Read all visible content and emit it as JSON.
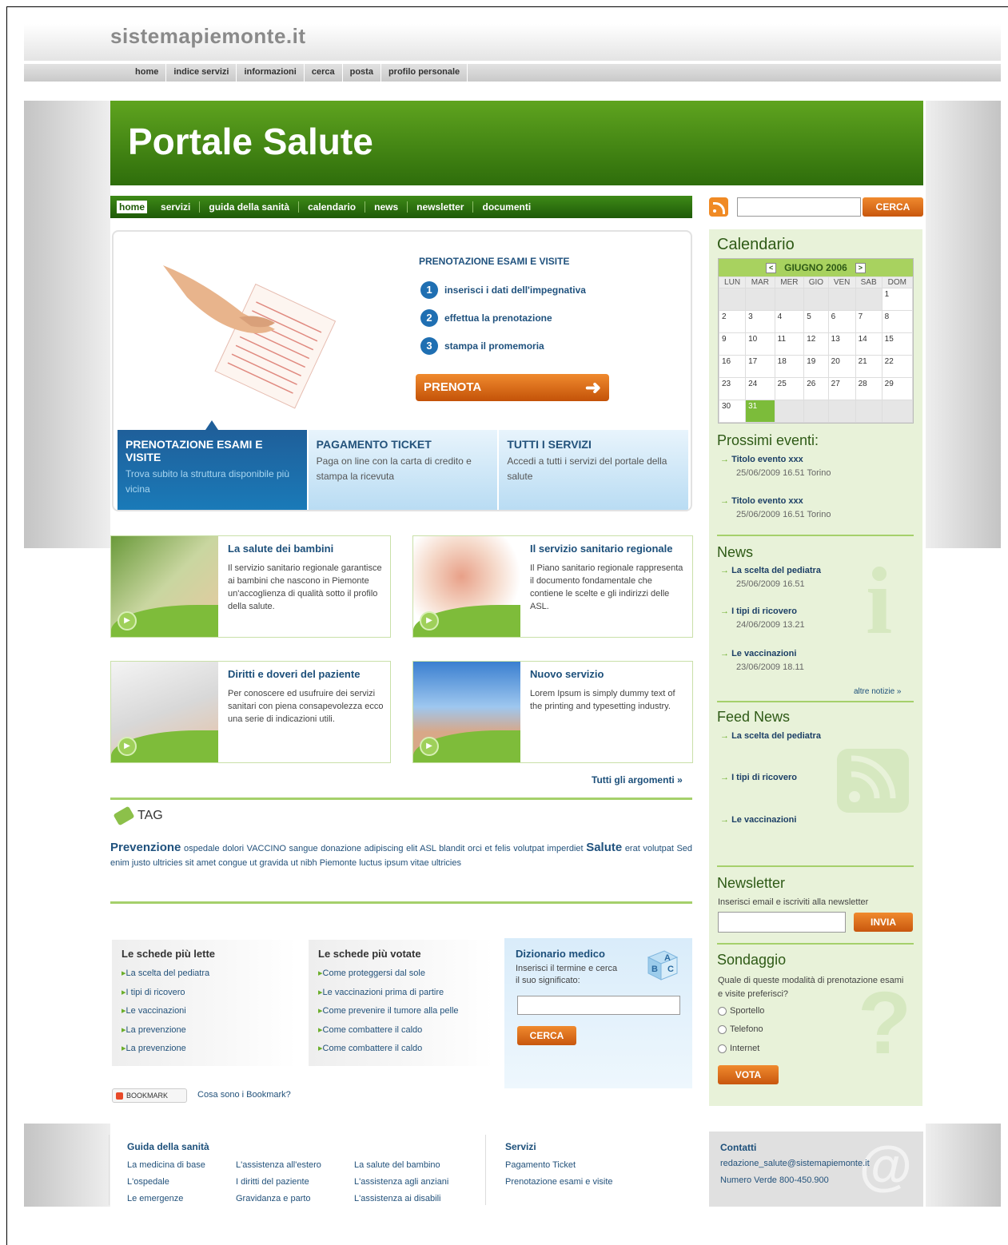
{
  "site": {
    "logo": "sistemapiemonte.it"
  },
  "top_nav": [
    "home",
    "indice servizi",
    "informazioni",
    "cerca",
    "posta",
    "profilo personale"
  ],
  "hero": {
    "title": "Portale Salute"
  },
  "main_nav": [
    "home",
    "servizi",
    "guida della sanità",
    "calendario",
    "news",
    "newsletter",
    "documenti"
  ],
  "search": {
    "button": "CERCA"
  },
  "booking": {
    "title": "PRENOTAZIONE ESAMI E VISITE",
    "steps": [
      {
        "num": "1",
        "text": "inserisci i dati dell'impegnativa"
      },
      {
        "num": "2",
        "text": "effettua la prenotazione"
      },
      {
        "num": "3",
        "text": "stampa il promemoria"
      }
    ],
    "button": "PRENOTA",
    "tabs": [
      {
        "title": "PRENOTAZIONE ESAMI E VISITE",
        "text": "Trova subito la struttura disponibile più vicina"
      },
      {
        "title": "PAGAMENTO TICKET",
        "text": "Paga on line con la carta di credito e stampa la ricevuta"
      },
      {
        "title": "TUTTI I SERVIZI",
        "text": "Accedi a tutti i servizi del portale della salute"
      }
    ]
  },
  "cards": [
    {
      "title": "La salute dei bambini",
      "text": "Il servizio sanitario regionale garantisce ai bambini che nascono in Piemonte un'accoglienza di qualità sotto il profilo della salute."
    },
    {
      "title": "Il servizio sanitario regionale",
      "text": "Il Piano sanitario regionale rappresenta il documento fondamentale che contiene le scelte e gli indirizzi delle ASL."
    },
    {
      "title": "Diritti e doveri del paziente",
      "text": "Per conoscere ed usufruire dei servizi sanitari con piena consapevolezza ecco una serie di indicazioni utili."
    },
    {
      "title": "Nuovo servizio",
      "text": "Lorem Ipsum is simply dummy text of the printing and typesetting industry."
    }
  ],
  "all_topics": "Tutti gli argomenti »",
  "tags": {
    "title": "TAG",
    "big1": "Prevenzione",
    "mid1": "ospedale dolori VACCINO sangue donazione adipiscing elit ASL blandit orci et felis volutpat imperdiet",
    "big2": "Salute",
    "mid2": "erat volutpat Sed enim justo ultricies sit amet congue ut gravida ut nibh Piemonte luctus ipsum vitae ultricies"
  },
  "most_read": {
    "title": "Le schede più lette",
    "items": [
      "La scelta del pediatra",
      "I tipi di ricovero",
      "Le vaccinazioni",
      "La prevenzione",
      "La prevenzione"
    ]
  },
  "most_voted": {
    "title": "Le schede più votate",
    "items": [
      "Come proteggersi dal sole",
      "Le vaccinazioni prima di partire",
      "Come prevenire il tumore alla pelle",
      "Come combattere il caldo",
      "Come combattere il caldo"
    ]
  },
  "dictionary": {
    "title": "Dizionario medico",
    "text": "Inserisci il termine e cerca il suo significato:",
    "button": "CERCA"
  },
  "bookmark": {
    "label": "BOOKMARK",
    "link": "Cosa sono i Bookmark?"
  },
  "calendar": {
    "title": "Calendario",
    "month": "GIUGNO 2006",
    "prev": "<",
    "next": ">",
    "days": [
      "LUN",
      "MAR",
      "MER",
      "GIO",
      "VEN",
      "SAB",
      "DOM"
    ],
    "weeks": [
      [
        "",
        "",
        "",
        "",
        "",
        "",
        "1"
      ],
      [
        "2",
        "3",
        "4",
        "5",
        "6",
        "7",
        "8"
      ],
      [
        "9",
        "10",
        "11",
        "12",
        "13",
        "14",
        "15"
      ],
      [
        "16",
        "17",
        "18",
        "19",
        "20",
        "21",
        "22"
      ],
      [
        "23",
        "24",
        "25",
        "26",
        "27",
        "28",
        "29"
      ],
      [
        "30",
        "31",
        "",
        "",
        "",
        "",
        ""
      ]
    ],
    "highlight": "31"
  },
  "events": {
    "title": "Prossimi eventi:",
    "items": [
      {
        "title": "Titolo evento xxx",
        "date": "25/06/2009    16.51 Torino"
      },
      {
        "title": "Titolo evento xxx",
        "date": "25/06/2009    16.51 Torino"
      }
    ]
  },
  "news": {
    "title": "News",
    "items": [
      {
        "title": "La scelta del pediatra",
        "date": "25/06/2009    16.51"
      },
      {
        "title": "I tipi di ricovero",
        "date": "24/06/2009    13.21"
      },
      {
        "title": "Le vaccinazioni",
        "date": "23/06/2009    18.11"
      }
    ],
    "more": "altre notizie »"
  },
  "feed": {
    "title": "Feed News",
    "items": [
      "La scelta del pediatra",
      "I tipi di ricovero",
      "Le vaccinazioni"
    ]
  },
  "newsletter": {
    "title": "Newsletter",
    "text": "Inserisci email e iscriviti alla newsletter",
    "button": "INVIA"
  },
  "poll": {
    "title": "Sondaggio",
    "question": "Quale di queste modalità di prenotazione esami e visite preferisci?",
    "options": [
      "Sportello",
      "Telefono",
      "Internet"
    ],
    "button": "VOTA"
  },
  "footer": {
    "guide": {
      "title": "Guida della sanità",
      "col1": [
        "La medicina di base",
        "L'ospedale",
        "Le emergenze"
      ],
      "col2": [
        "L'assistenza all'estero",
        "I diritti del paziente",
        "Gravidanza e parto"
      ],
      "col3": [
        "La salute del bambino",
        "L'assistenza agli anziani",
        "L'assistenza ai disabili"
      ]
    },
    "services": {
      "title": "Servizi",
      "items": [
        "Pagamento Ticket",
        "Prenotazione esami e visite"
      ]
    },
    "contacts": {
      "title": "Contatti",
      "email": "redazione_salute@sistemapiemonte.it",
      "phone": "Numero Verde 800-450.900"
    }
  }
}
